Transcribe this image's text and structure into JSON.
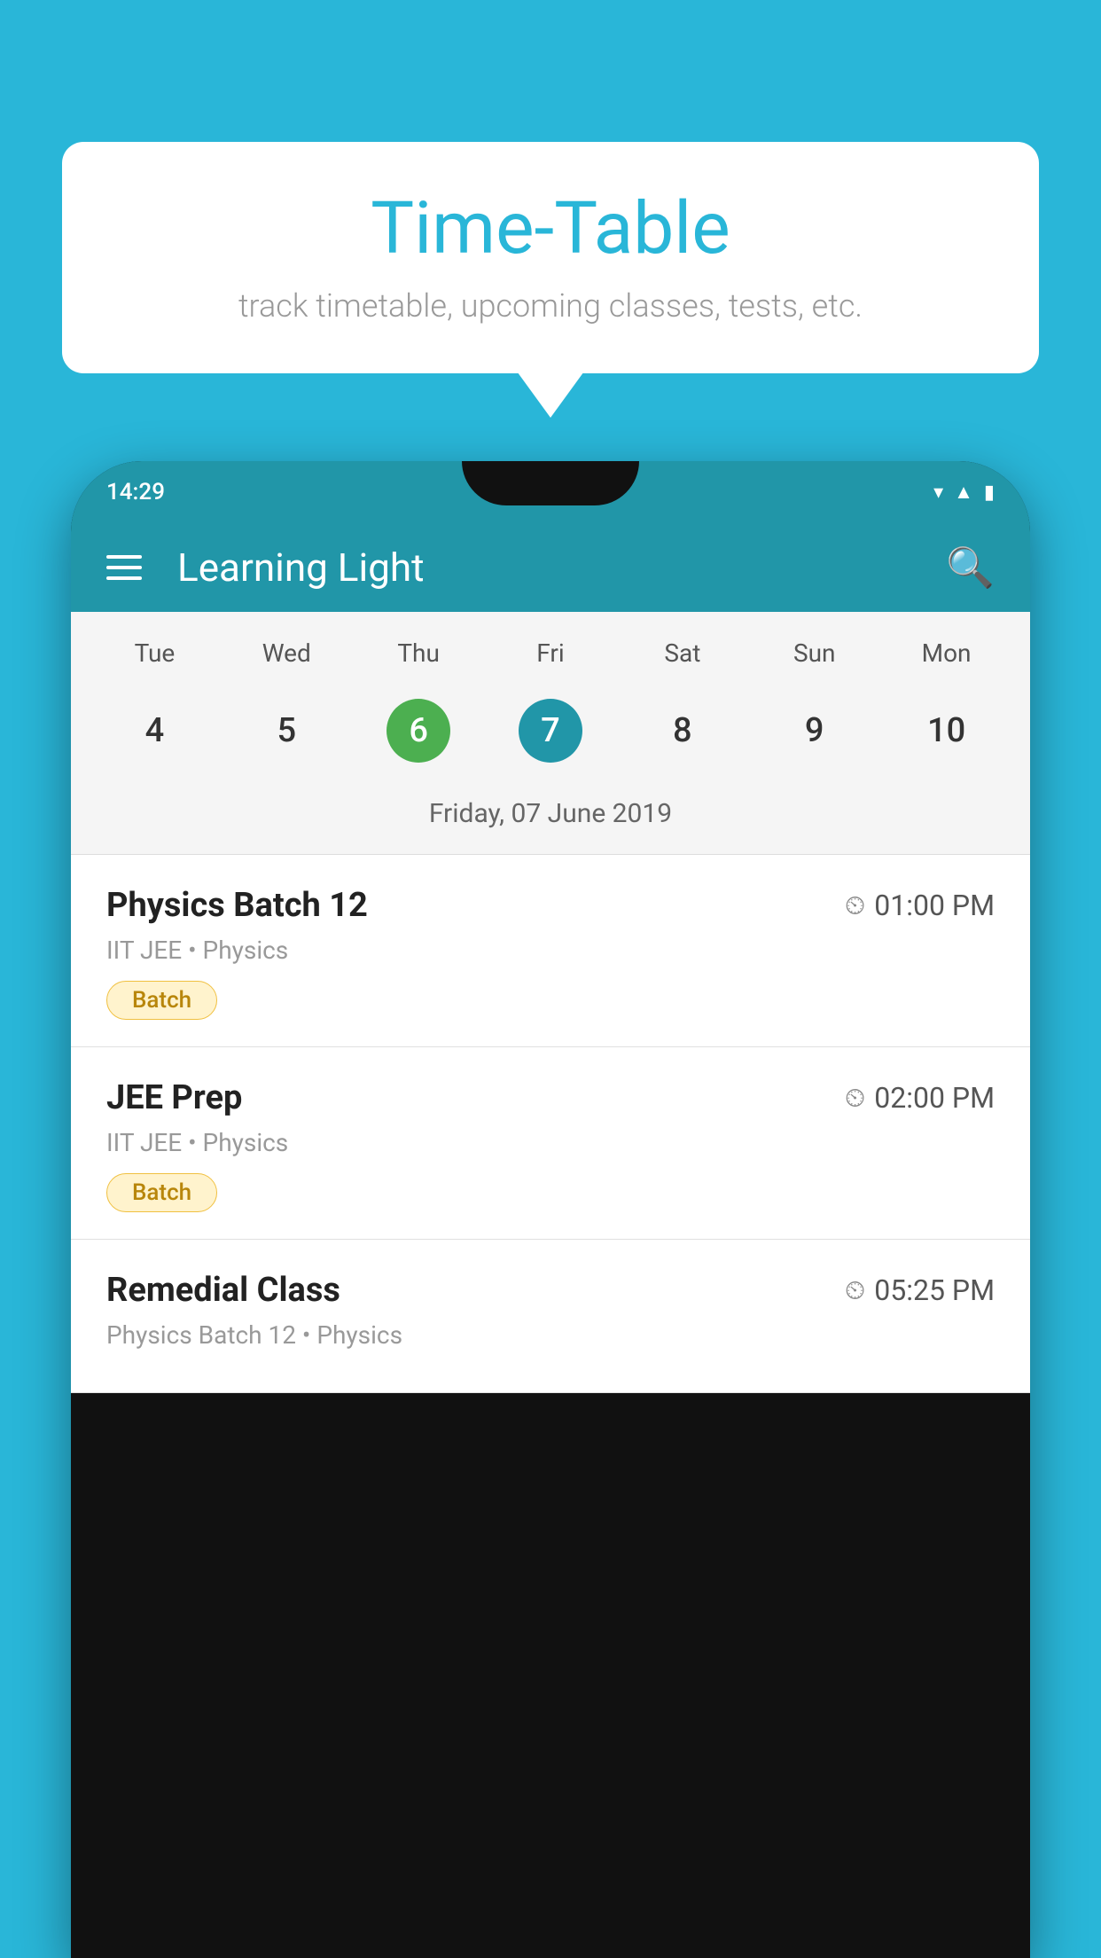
{
  "background": {
    "color": "#29B6D8"
  },
  "speech_bubble": {
    "title": "Time-Table",
    "subtitle": "track timetable, upcoming classes, tests, etc."
  },
  "app_bar": {
    "title": "Learning Light",
    "menu_icon": "hamburger-icon",
    "search_icon": "search-icon"
  },
  "status_bar": {
    "time": "14:29"
  },
  "calendar": {
    "selected_date_label": "Friday, 07 June 2019",
    "days": [
      "Tue",
      "Wed",
      "Thu",
      "Fri",
      "Sat",
      "Sun",
      "Mon"
    ],
    "dates": [
      {
        "number": "4",
        "style": "normal"
      },
      {
        "number": "5",
        "style": "normal"
      },
      {
        "number": "6",
        "style": "green"
      },
      {
        "number": "7",
        "style": "blue"
      },
      {
        "number": "8",
        "style": "normal"
      },
      {
        "number": "9",
        "style": "normal"
      },
      {
        "number": "10",
        "style": "normal"
      }
    ]
  },
  "schedule_items": [
    {
      "title": "Physics Batch 12",
      "time": "01:00 PM",
      "subtitle": "IIT JEE • Physics",
      "badge": "Batch"
    },
    {
      "title": "JEE Prep",
      "time": "02:00 PM",
      "subtitle": "IIT JEE • Physics",
      "badge": "Batch"
    },
    {
      "title": "Remedial Class",
      "time": "05:25 PM",
      "subtitle": "Physics Batch 12 • Physics",
      "badge": null
    }
  ]
}
